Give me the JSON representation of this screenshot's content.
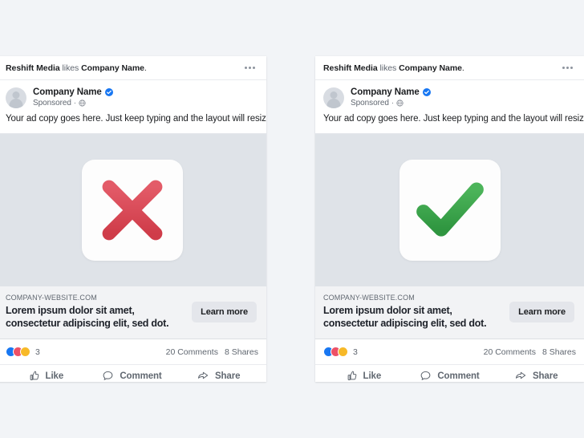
{
  "page": {
    "background_color": "#f2f4f7",
    "card_background": "#ffffff",
    "creative_background": "#dfe3e8",
    "link_block_background": "#f2f3f5"
  },
  "cards": [
    {
      "id": "bad-example",
      "social_context": {
        "actor": "Reshift Media",
        "verb": "likes",
        "target": "Company Name",
        "period": "."
      },
      "more_menu": "...",
      "header": {
        "page_name": "Company Name",
        "verified_badge": "verified-badge-icon",
        "sponsored_label": "Sponsored",
        "separator": "·",
        "audience_icon": "globe-icon",
        "avatar": "default-page-avatar"
      },
      "ad_copy": "Your ad copy goes here. Just keep typing and the layout will resize itself!",
      "creative": {
        "mark": "cross-mark",
        "mark_color": "#de4655",
        "tile_color": "#fdfdfd"
      },
      "link": {
        "domain": "COMPANY-WEBSITE.COM",
        "headline_line1": "Lorem ipsum dolor sit amet, consectetur",
        "headline_line2": "adipiscing elit, sed dot.",
        "cta_label": "Learn more"
      },
      "engagement": {
        "reaction_colors": [
          "#1877f2",
          "#ed5167",
          "#f7b928"
        ],
        "reaction_count": "3",
        "comments": "20 Comments",
        "shares": "8 Shares"
      },
      "actions": [
        {
          "label": "Like",
          "icon": "thumbs-up-icon"
        },
        {
          "label": "Comment",
          "icon": "comment-bubble-icon"
        },
        {
          "label": "Share",
          "icon": "share-arrow-icon"
        }
      ]
    },
    {
      "id": "good-example",
      "social_context": {
        "actor": "Reshift Media",
        "verb": "likes",
        "target": "Company Name",
        "period": "."
      },
      "more_menu": "...",
      "header": {
        "page_name": "Company Name",
        "verified_badge": "verified-badge-icon",
        "sponsored_label": "Sponsored",
        "separator": "·",
        "audience_icon": "globe-icon",
        "avatar": "default-page-avatar"
      },
      "ad_copy": "Your ad copy goes here. Just keep typing and the layout will resize itself!",
      "creative": {
        "mark": "check-mark",
        "mark_color": "#3fa84b",
        "tile_color": "#fdfdfd"
      },
      "link": {
        "domain": "COMPANY-WEBSITE.COM",
        "headline_line1": "Lorem ipsum dolor sit amet, consectetur",
        "headline_line2": "adipiscing elit, sed dot.",
        "cta_label": "Learn more"
      },
      "engagement": {
        "reaction_colors": [
          "#1877f2",
          "#ed5167",
          "#f7b928"
        ],
        "reaction_count": "3",
        "comments": "20 Comments",
        "shares": "8 Shares"
      },
      "actions": [
        {
          "label": "Like",
          "icon": "thumbs-up-icon"
        },
        {
          "label": "Comment",
          "icon": "comment-bubble-icon"
        },
        {
          "label": "Share",
          "icon": "share-arrow-icon"
        }
      ]
    }
  ]
}
